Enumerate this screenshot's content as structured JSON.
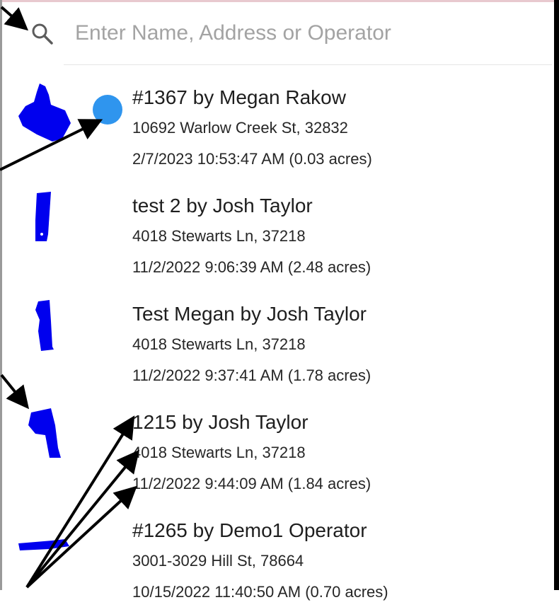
{
  "search": {
    "placeholder": "Enter Name, Address or Operator",
    "value": "",
    "icon": "search-icon"
  },
  "colors": {
    "polygon": "#0000ee",
    "selected_dot": "#2f95ee",
    "placeholder": "#a3a3a3"
  },
  "items": [
    {
      "title": "#1367 by Megan Rakow",
      "address": "10692 Warlow Creek St, 32832",
      "meta": "2/7/2023 10:53:47 AM (0.03 acres)",
      "selected": true
    },
    {
      "title": "test 2 by Josh Taylor",
      "address": "4018 Stewarts Ln, 37218",
      "meta": "11/2/2022 9:06:39 AM (2.48 acres)"
    },
    {
      "title": "Test Megan by Josh Taylor",
      "address": "4018 Stewarts Ln, 37218",
      "meta": "11/2/2022 9:37:41 AM (1.78 acres)"
    },
    {
      "title": "1215 by Josh Taylor",
      "address": "4018 Stewarts Ln, 37218",
      "meta": "11/2/2022 9:44:09 AM (1.84 acres)"
    },
    {
      "title": "#1265 by Demo1 Operator",
      "address": "3001-3029 Hill St, 78664",
      "meta": "10/15/2022 11:40:50 AM (0.70 acres)"
    }
  ]
}
